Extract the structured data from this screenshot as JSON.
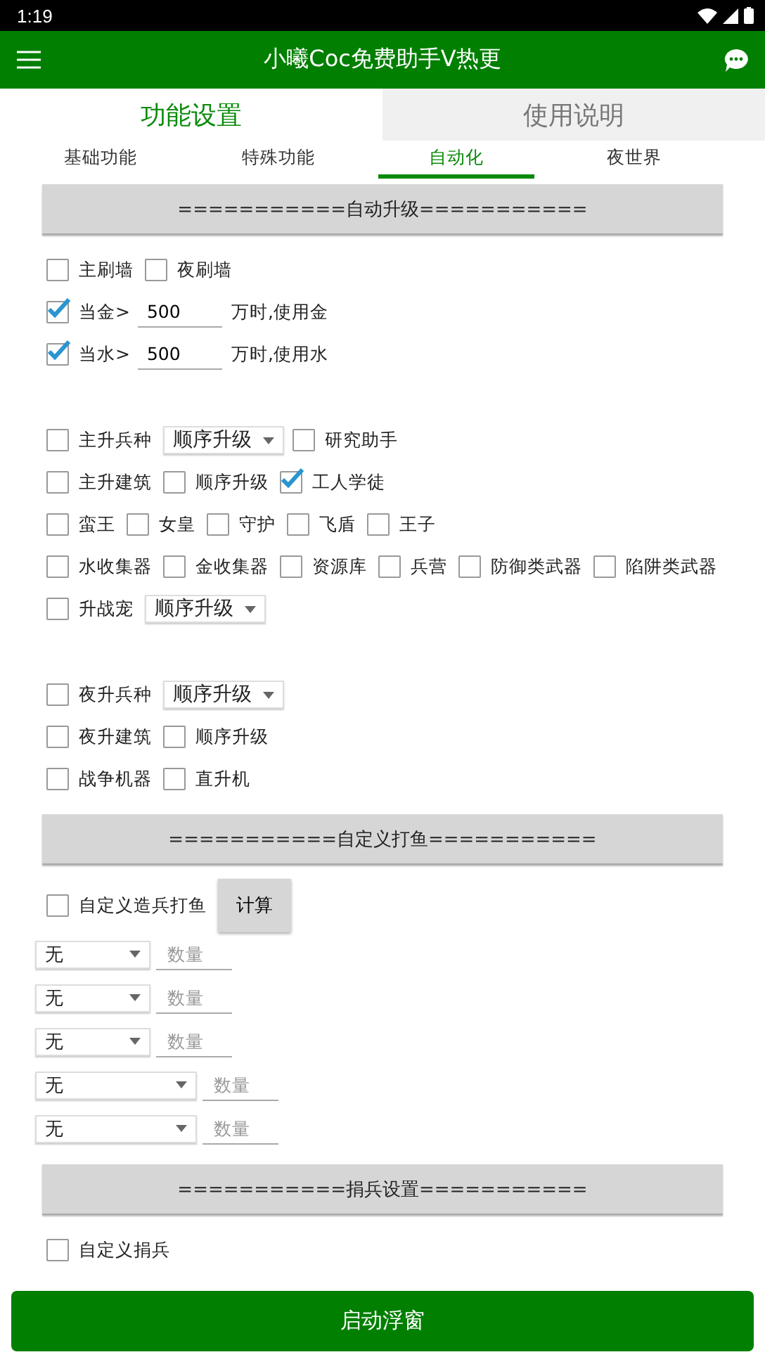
{
  "status_bar": {
    "time": "1:19"
  },
  "app_bar": {
    "title": "小曦Coc免费助手V热更"
  },
  "main_tabs": [
    {
      "label": "功能设置",
      "selected": true
    },
    {
      "label": "使用说明",
      "selected": false
    }
  ],
  "sub_tabs": [
    {
      "label": "基础功能",
      "selected": false
    },
    {
      "label": "特殊功能",
      "selected": false
    },
    {
      "label": "自动化",
      "selected": true
    },
    {
      "label": "夜世界",
      "selected": false
    }
  ],
  "sections": [
    {
      "title": "===========自动升级===========",
      "groups": [
        {
          "rows": [
            {
              "items": [
                {
                  "kind": "checkbox",
                  "label": "主刷墙",
                  "checked": false
                },
                {
                  "kind": "checkbox",
                  "label": "夜刷墙",
                  "checked": false
                }
              ]
            },
            {
              "items": [
                {
                  "kind": "checkbox",
                  "label": "当金>",
                  "checked": true
                },
                {
                  "kind": "field",
                  "value": "500"
                },
                {
                  "kind": "text",
                  "text": "万时,使用金"
                }
              ]
            },
            {
              "items": [
                {
                  "kind": "checkbox",
                  "label": "当水>",
                  "checked": true
                },
                {
                  "kind": "field",
                  "value": "500"
                },
                {
                  "kind": "text",
                  "text": "万时,使用水"
                }
              ]
            }
          ]
        },
        {
          "rows": [
            {
              "items": [
                {
                  "kind": "checkbox",
                  "label": "主升兵种",
                  "checked": false
                },
                {
                  "kind": "dropdown",
                  "value": "顺序升级"
                },
                {
                  "kind": "checkbox",
                  "label": "研究助手",
                  "checked": false
                }
              ]
            },
            {
              "items": [
                {
                  "kind": "checkbox",
                  "label": "主升建筑",
                  "checked": false
                },
                {
                  "kind": "checkbox",
                  "label": "顺序升级",
                  "checked": false
                },
                {
                  "kind": "checkbox",
                  "label": "工人学徒",
                  "checked": true
                }
              ]
            },
            {
              "items": [
                {
                  "kind": "checkbox",
                  "label": "蛮王",
                  "checked": false
                },
                {
                  "kind": "checkbox",
                  "label": "女皇",
                  "checked": false
                },
                {
                  "kind": "checkbox",
                  "label": "守护",
                  "checked": false
                },
                {
                  "kind": "checkbox",
                  "label": "飞盾",
                  "checked": false
                },
                {
                  "kind": "checkbox",
                  "label": "王子",
                  "checked": false
                }
              ]
            },
            {
              "items": [
                {
                  "kind": "checkbox",
                  "label": "水收集器",
                  "checked": false
                },
                {
                  "kind": "checkbox",
                  "label": "金收集器",
                  "checked": false
                },
                {
                  "kind": "checkbox",
                  "label": "资源库",
                  "checked": false
                },
                {
                  "kind": "checkbox",
                  "label": "兵营",
                  "checked": false
                },
                {
                  "kind": "checkbox",
                  "label": "防御类武器",
                  "checked": false
                },
                {
                  "kind": "checkbox",
                  "label": "陷阱类武器",
                  "checked": false
                }
              ]
            },
            {
              "items": [
                {
                  "kind": "checkbox",
                  "label": "升战宠",
                  "checked": false
                },
                {
                  "kind": "dropdown",
                  "value": "顺序升级"
                }
              ]
            }
          ]
        },
        {
          "rows": [
            {
              "items": [
                {
                  "kind": "checkbox",
                  "label": "夜升兵种",
                  "checked": false
                },
                {
                  "kind": "dropdown",
                  "value": "顺序升级"
                }
              ]
            },
            {
              "items": [
                {
                  "kind": "checkbox",
                  "label": "夜升建筑",
                  "checked": false
                },
                {
                  "kind": "checkbox",
                  "label": "顺序升级",
                  "checked": false
                }
              ]
            },
            {
              "items": [
                {
                  "kind": "checkbox",
                  "label": "战争机器",
                  "checked": false
                },
                {
                  "kind": "checkbox",
                  "label": "直升机",
                  "checked": false
                }
              ]
            }
          ]
        }
      ]
    },
    {
      "title": "===========自定义打鱼===========",
      "groups": [
        {
          "rows": [
            {
              "items": [
                {
                  "kind": "checkbox",
                  "label": "自定义造兵打鱼",
                  "checked": false
                },
                {
                  "kind": "button",
                  "label": "计算"
                }
              ]
            },
            {
              "items": [
                {
                  "kind": "select",
                  "value": "无"
                },
                {
                  "kind": "input",
                  "placeholder": "数量"
                }
              ]
            },
            {
              "items": [
                {
                  "kind": "select",
                  "value": "无"
                },
                {
                  "kind": "input",
                  "placeholder": "数量"
                }
              ]
            },
            {
              "items": [
                {
                  "kind": "select",
                  "value": "无"
                },
                {
                  "kind": "input",
                  "placeholder": "数量"
                }
              ]
            },
            {
              "items": [
                {
                  "kind": "longselect",
                  "value": "无"
                },
                {
                  "kind": "input",
                  "placeholder": "数量"
                }
              ]
            },
            {
              "items": [
                {
                  "kind": "longselect",
                  "value": "无"
                },
                {
                  "kind": "input",
                  "placeholder": "数量"
                }
              ]
            }
          ]
        }
      ]
    },
    {
      "title": "===========捐兵设置===========",
      "groups": [
        {
          "rows": [
            {
              "items": [
                {
                  "kind": "checkbox",
                  "label": "自定义捐兵",
                  "checked": false
                }
              ]
            }
          ]
        }
      ]
    }
  ],
  "start_button": {
    "label": "启动浮窗"
  }
}
